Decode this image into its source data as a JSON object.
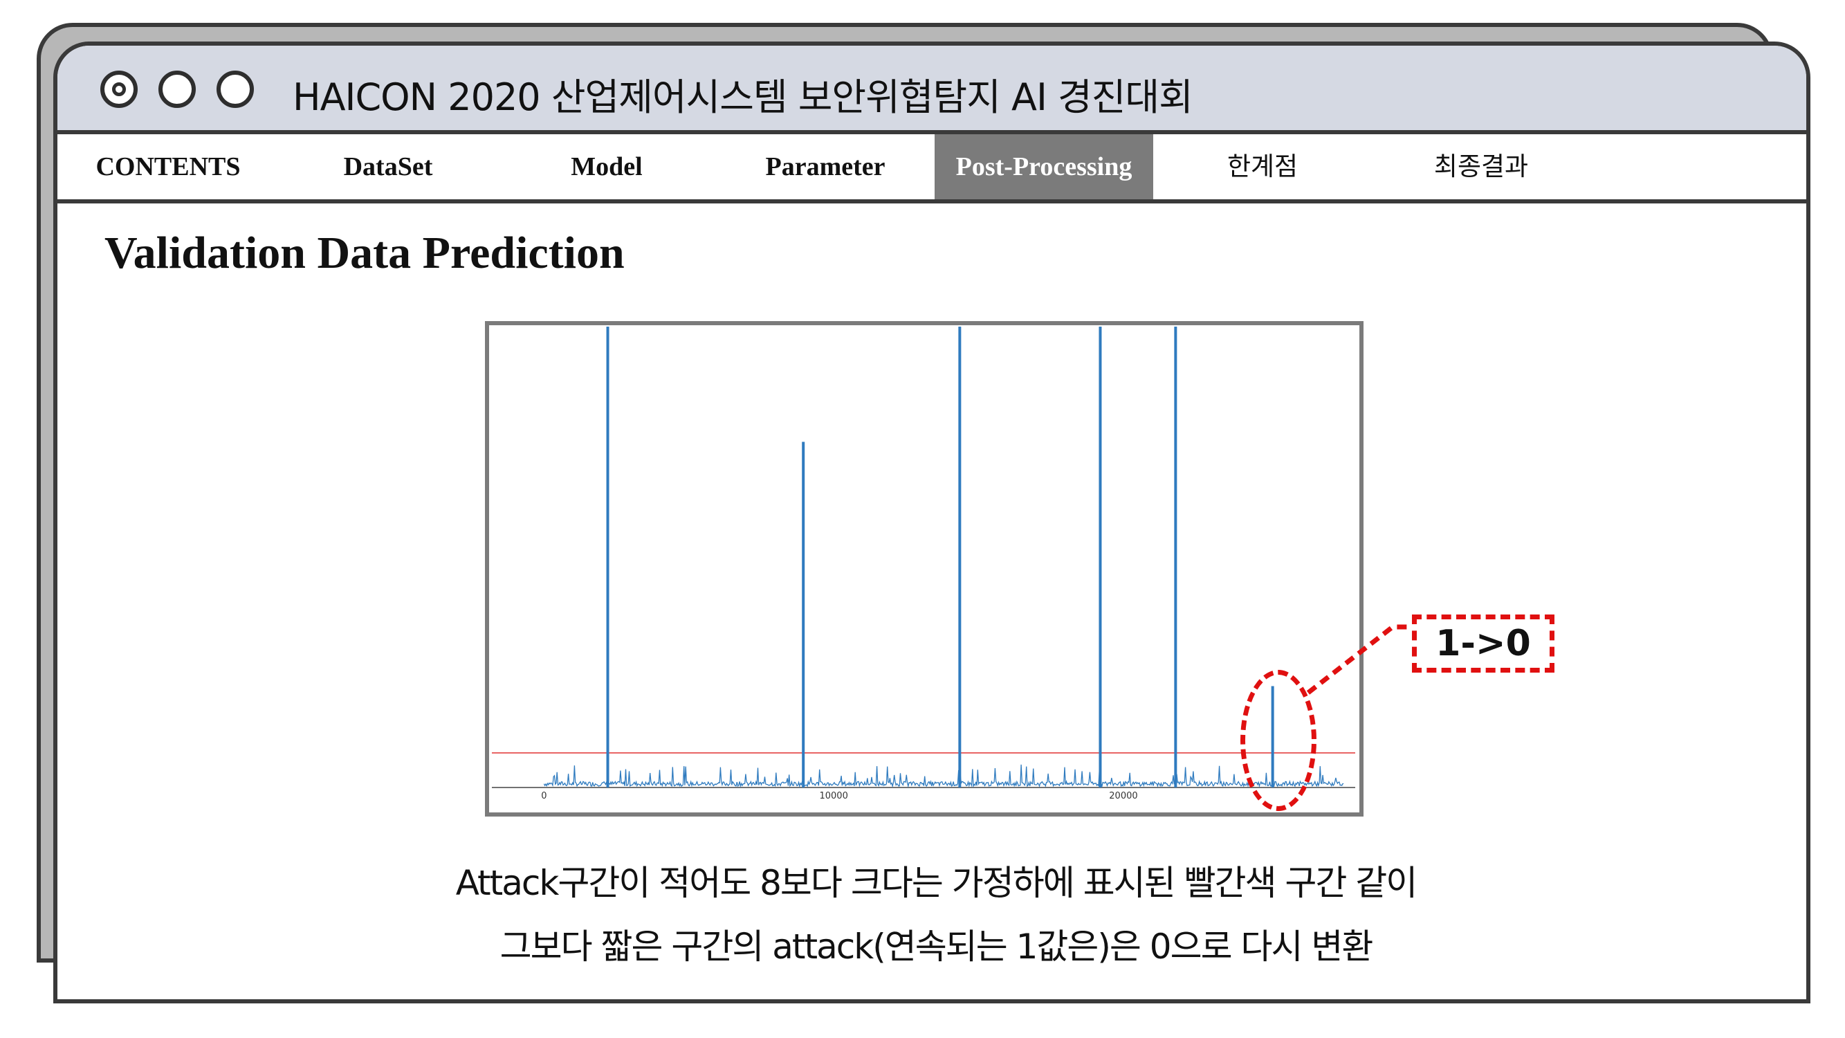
{
  "window": {
    "title": "HAICON 2020 산업제어시스템 보안위협탐지 AI 경진대회",
    "controls": [
      "record-icon",
      "circle-icon",
      "circle-icon"
    ]
  },
  "nav": {
    "tabs": [
      {
        "label": "CONTENTS",
        "active": false
      },
      {
        "label": "DataSet",
        "active": false
      },
      {
        "label": "Model",
        "active": false
      },
      {
        "label": "Parameter",
        "active": false
      },
      {
        "label": "Post-Processing",
        "active": true
      },
      {
        "label": "한계점",
        "active": false
      },
      {
        "label": "최종결과",
        "active": false
      }
    ],
    "active_color": "#7b7b7b"
  },
  "main": {
    "heading": "Validation Data Prediction",
    "callout_label": "1->0",
    "callout_color": "#e01010",
    "caption_line1": "Attack구간이 적어도 8보다 크다는 가정하에 표시된 빨간색 구간 같이",
    "caption_line2": "그보다 짧은 구간의 attack(연속되는 1값은)은 0으로 다시 변환"
  },
  "chart_data": {
    "type": "line",
    "x_ticks": [
      0,
      10000,
      20000
    ],
    "xlim": [
      -1800,
      28000
    ],
    "ylim": [
      0,
      1
    ],
    "threshold": 0.075,
    "series_color": "#2f7bbf",
    "threshold_color": "#e03030",
    "spikes": [
      {
        "x": 2200,
        "y": 1.0
      },
      {
        "x": 8950,
        "y": 0.75
      },
      {
        "x": 14350,
        "y": 1.0
      },
      {
        "x": 19200,
        "y": 1.0
      },
      {
        "x": 21800,
        "y": 1.0
      },
      {
        "x": 25150,
        "y": 0.22
      }
    ],
    "baseline_noise": 0.01
  }
}
